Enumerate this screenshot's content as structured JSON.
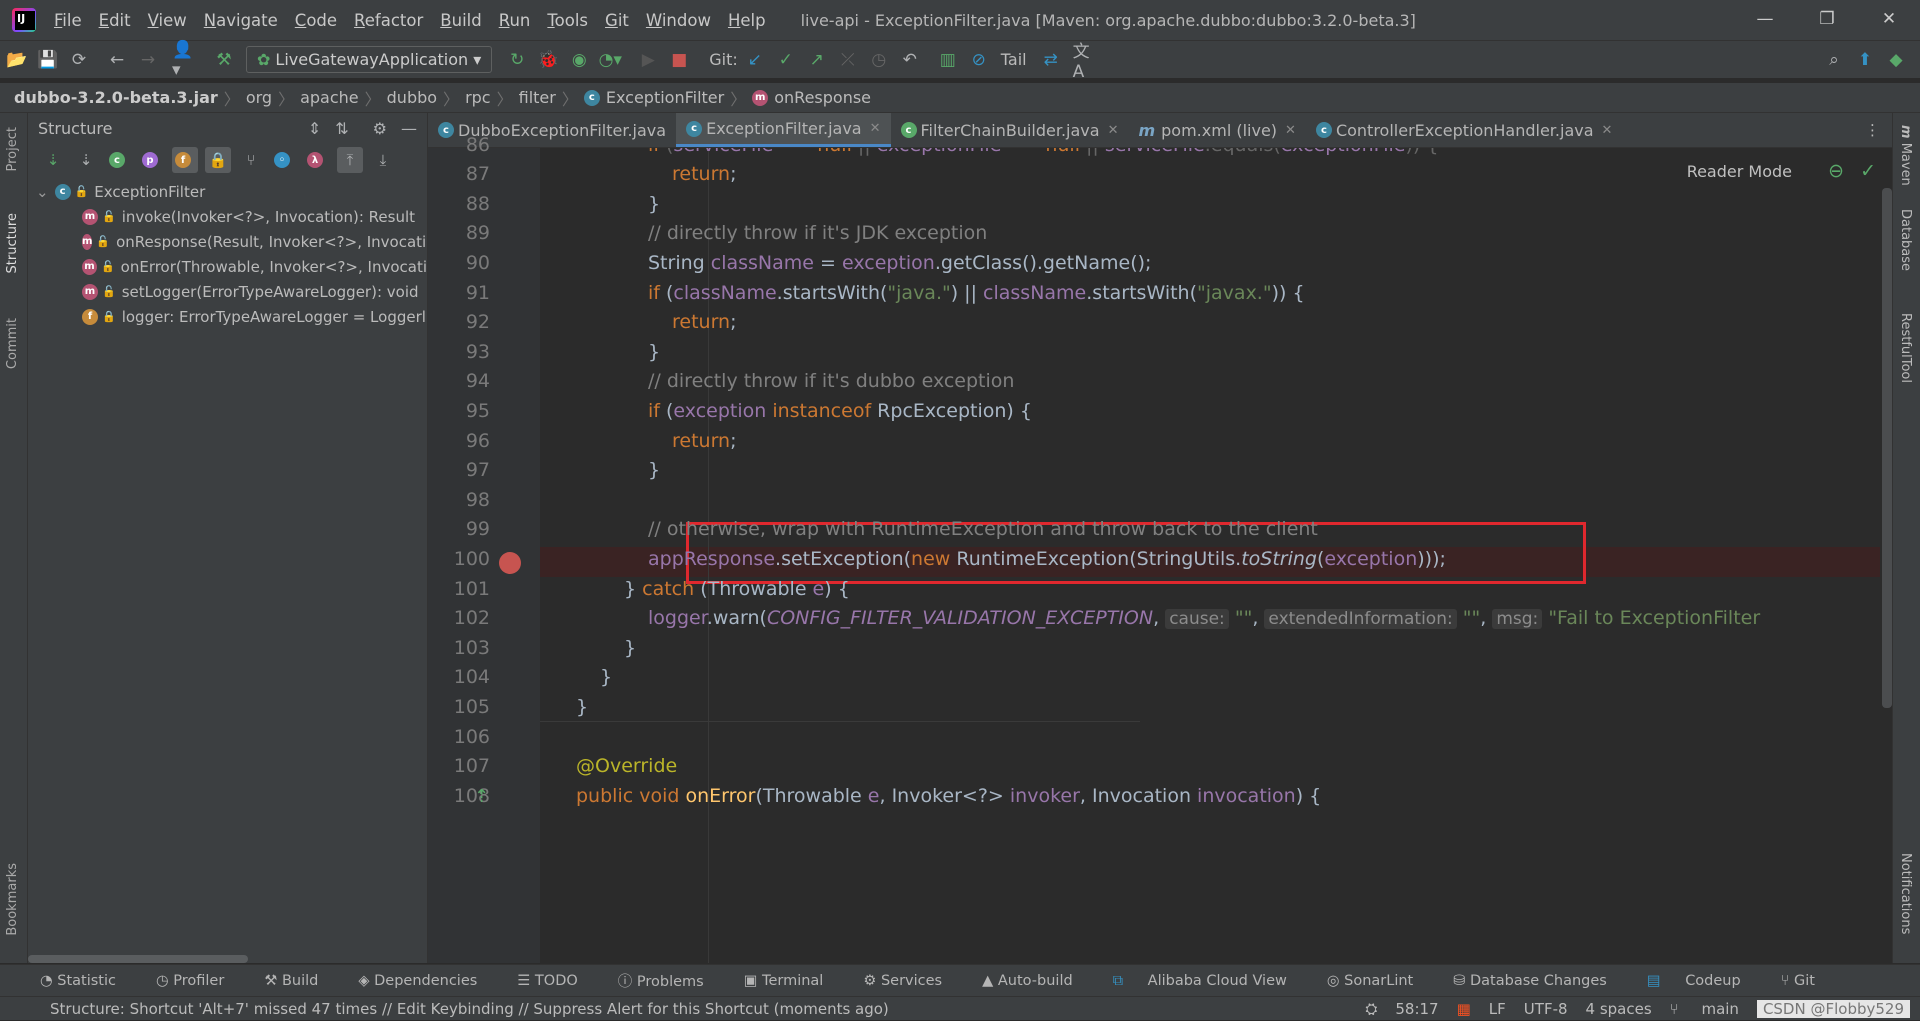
{
  "window": {
    "title": "live-api - ExceptionFilter.java [Maven: org.apache.dubbo:dubbo:3.2.0-beta.3]",
    "menu": [
      "File",
      "Edit",
      "View",
      "Navigate",
      "Code",
      "Refactor",
      "Build",
      "Run",
      "Tools",
      "Git",
      "Window",
      "Help"
    ]
  },
  "toolbar": {
    "run_config": "LiveGatewayApplication",
    "git_label": "Git:",
    "tail_label": "Tail"
  },
  "breadcrumb": [
    "dubbo-3.2.0-beta.3.jar",
    "org",
    "apache",
    "dubbo",
    "rpc",
    "filter",
    "ExceptionFilter",
    "onResponse"
  ],
  "sidebar_left": {
    "project": "Project",
    "structure": "Structure",
    "commit": "Commit",
    "bookmarks": "Bookmarks"
  },
  "structure": {
    "title": "Structure",
    "root": "ExceptionFilter",
    "items": [
      {
        "kind": "m",
        "label": "invoke(Invoker<?>, Invocation): Result"
      },
      {
        "kind": "m",
        "label": "onResponse(Result, Invoker<?>, Invocatio"
      },
      {
        "kind": "m",
        "label": "onError(Throwable, Invoker<?>, Invocati"
      },
      {
        "kind": "m",
        "label": "setLogger(ErrorTypeAwareLogger): void"
      },
      {
        "kind": "f",
        "label": "logger: ErrorTypeAwareLogger = Loggerl"
      }
    ]
  },
  "tabs": [
    {
      "label": "DubboExceptionFilter.java",
      "icon": "c"
    },
    {
      "label": "ExceptionFilter.java",
      "icon": "c",
      "active": true
    },
    {
      "label": "FilterChainBuilder.java",
      "icon": "c"
    },
    {
      "label": "pom.xml (live)",
      "icon": "m"
    },
    {
      "label": "ControllerExceptionHandler.java",
      "icon": "c"
    }
  ],
  "editor": {
    "reader_mode": "Reader Mode",
    "line_numbers": [
      "86",
      "87",
      "88",
      "89",
      "90",
      "91",
      "92",
      "93",
      "94",
      "95",
      "96",
      "97",
      "98",
      "99",
      "100",
      "101",
      "102",
      "103",
      "104",
      "105",
      "106",
      "107",
      "108"
    ],
    "hints": {
      "cause": "cause:",
      "extended": "extendedInformation:",
      "msg": "msg:"
    },
    "strings": {
      "empty": "\"\"",
      "fail": "\"Fail to ExceptionFilter",
      "java": "\"java.\"",
      "javax": "\"javax.\""
    },
    "comments": {
      "jdk": "// directly throw if it's JDK exception",
      "dubbo": "// directly throw if it's dubbo exception",
      "otherwise": "// otherwise, wrap with RuntimeException and throw back to the client"
    }
  },
  "sidebar_right": {
    "maven": "Maven",
    "database": "Database",
    "restful": "RestfulTool",
    "notifications": "Notifications"
  },
  "bottom_tools": [
    "Statistic",
    "Profiler",
    "Build",
    "Dependencies",
    "TODO",
    "Problems",
    "Terminal",
    "Services",
    "Auto-build",
    "Alibaba Cloud View",
    "SonarLint",
    "Database Changes",
    "Codeup",
    "Git"
  ],
  "status": {
    "message": "Structure: Shortcut 'Alt+7' missed 47 times // Edit Keybinding // Suppress Alert for this Shortcut (moments ago)",
    "position": "58:17",
    "line_sep": "LF",
    "encoding": "UTF-8",
    "indent": "4 spaces",
    "branch": "main",
    "watermark": "CSDN @Flobby529"
  },
  "colors": {
    "breakpoint": "#c75450",
    "highlight_box": "#e0282e",
    "keyword": "#cc7832",
    "field": "#9876aa",
    "string": "#6a8759",
    "method": "#ffc66d"
  }
}
